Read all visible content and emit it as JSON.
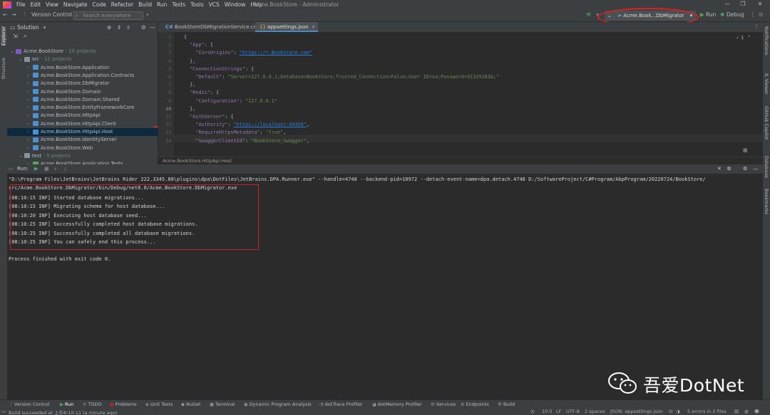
{
  "window": {
    "title": "Acme.BookStore - Administrator",
    "menu": [
      "File",
      "Edit",
      "View",
      "Navigate",
      "Code",
      "Refactor",
      "Build",
      "Run",
      "Tests",
      "Tools",
      "VCS",
      "Window",
      "Help"
    ]
  },
  "toolbar": {
    "version_control": "Version Control",
    "search_placeholder": "Search everywhere",
    "run_config": "Acme.Book...DbMigrator",
    "run_label": "Run",
    "debug_label": "Debug"
  },
  "left_strip": {
    "explorer": "Explorer",
    "structure": "Structure"
  },
  "right_strip": {
    "notifications": "Notifications",
    "il_viewer": "IL Viewer",
    "github_copilot": "GitHub Copilot",
    "database": "Database",
    "bookmarks": "Bookmarks"
  },
  "solution": {
    "title": "Solution",
    "items": [
      {
        "label": "Acme.BookStore",
        "extra": "· 16 projects",
        "level": 0,
        "arrow": "v",
        "kind": "sln"
      },
      {
        "label": "src",
        "extra": "· 11 projects",
        "level": 1,
        "arrow": "v",
        "kind": "folder"
      },
      {
        "label": "Acme.BookStore.Application",
        "extra": "",
        "level": 2,
        "arrow": ">",
        "kind": "proj"
      },
      {
        "label": "Acme.BookStore.Application.Contracts",
        "extra": "",
        "level": 2,
        "arrow": ">",
        "kind": "proj"
      },
      {
        "label": "Acme.BookStore.DbMigrator",
        "extra": "",
        "level": 2,
        "arrow": ">",
        "kind": "proj"
      },
      {
        "label": "Acme.BookStore.Domain",
        "extra": "",
        "level": 2,
        "arrow": ">",
        "kind": "proj"
      },
      {
        "label": "Acme.BookStore.Domain.Shared",
        "extra": "",
        "level": 2,
        "arrow": ">",
        "kind": "proj"
      },
      {
        "label": "Acme.BookStore.EntityFrameworkCore",
        "extra": "",
        "level": 2,
        "arrow": ">",
        "kind": "proj"
      },
      {
        "label": "Acme.BookStore.HttpApi",
        "extra": "",
        "level": 2,
        "arrow": ">",
        "kind": "proj"
      },
      {
        "label": "Acme.BookStore.HttpApi.Client",
        "extra": "",
        "level": 2,
        "arrow": ">",
        "kind": "proj"
      },
      {
        "label": "Acme.BookStore.HttpApi.Host",
        "extra": "",
        "level": 2,
        "arrow": ">",
        "kind": "proj",
        "selected": true
      },
      {
        "label": "Acme.BookStore.IdentityServer",
        "extra": "",
        "level": 2,
        "arrow": ">",
        "kind": "proj"
      },
      {
        "label": "Acme.BookStore.Web",
        "extra": "",
        "level": 2,
        "arrow": ">",
        "kind": "proj"
      },
      {
        "label": "test",
        "extra": "· 5 projects",
        "level": 1,
        "arrow": "v",
        "kind": "folder"
      },
      {
        "label": "Acme.BookStore.Application.Tests",
        "extra": "",
        "level": 2,
        "arrow": ">",
        "kind": "test"
      }
    ]
  },
  "editor": {
    "tabs": [
      {
        "label": "BookStoreDbMigrationService.cs",
        "icon": "C#",
        "active": false
      },
      {
        "label": "appsettings.json",
        "icon": "{}",
        "active": true
      }
    ],
    "line_numbers": [
      "1",
      "2",
      "3",
      "4",
      "5",
      "6",
      "7",
      "8",
      "9",
      "10",
      "11",
      "12",
      "13",
      "14"
    ],
    "current_line": "10",
    "lines": [
      "{",
      "  \"App\": {",
      "    \"CorsOrigins\": \"https://*.BookStore.com\"",
      "  },",
      "  \"ConnectionStrings\": {",
      "    \"Default\": \"Server=127.0.0.1;Database=BookStore;Trusted_Connection=False;User ID=sa;Password=91329283&;\"",
      "  },",
      "  \"Redis\": {",
      "    \"Configuration\": \"127.0.0.1\"",
      "  },",
      "  \"AuthServer\": {",
      "    \"Authority\": \"https://localhost:44396\",",
      "    \"RequireHttpsMetadata\": \"true\",",
      "    \"SwaggerClientId\": \"BookStore_Swagger\","
    ],
    "breadcrumb": "Acme.BookStore.HttpApi.Host",
    "inspection_count": "1"
  },
  "run": {
    "title": "Run:",
    "tab_label": "Acme.BookStore.DbMigrator",
    "command_line_1": "\"D:\\Program Files\\JetBrains\\JetBrains Rider 222.3345.88\\plugins\\dpa\\DotFiles\\JetBrains.DPA.Runner.exe\" --handle=4748 --backend-pid=18972 --detach-event-name=dpa.detach.4748 D:/SoftwareProject/C#Program/AbpProgram/20220724/BookStore/",
    "command_line_2": "src/Acme.BookStore.DbMigrator/bin/Debug/net6.0/Acme.BookStore.DbMigrator.exe",
    "log": [
      "[08:10:15 INF] Started database migrations...",
      "[08:10:15 INF] Migrating schema for host database...",
      "[08:10:20 INF] Executing host database seed...",
      "[08:10:25 INF] Successfully completed host database migrations.",
      "[08:10:25 INF] Successfully completed all database migrations.",
      "[08:10:25 INF] You can safely end this process..."
    ],
    "finished": "Process finished with exit code 0."
  },
  "watermark": {
    "text": "吾爱DotNet"
  },
  "tool_tabs": [
    "Version Control",
    "Run",
    "TODO",
    "Problems",
    "Unit Tests",
    "NuGet",
    "Terminal",
    "Dynamic Program Analysis",
    "dotTrace Profiler",
    "dotMemory Profiler",
    "Services",
    "Endpoints",
    "Build"
  ],
  "status": {
    "message": "Build succeeded at 上午8:10:11 (a minute ago)",
    "position": "10:5",
    "line_sep": "LF",
    "encoding": "UTF-8",
    "indent": "2 spaces",
    "schema": "JSON: appsettings.json",
    "errors": "5 errors in 2 files"
  }
}
